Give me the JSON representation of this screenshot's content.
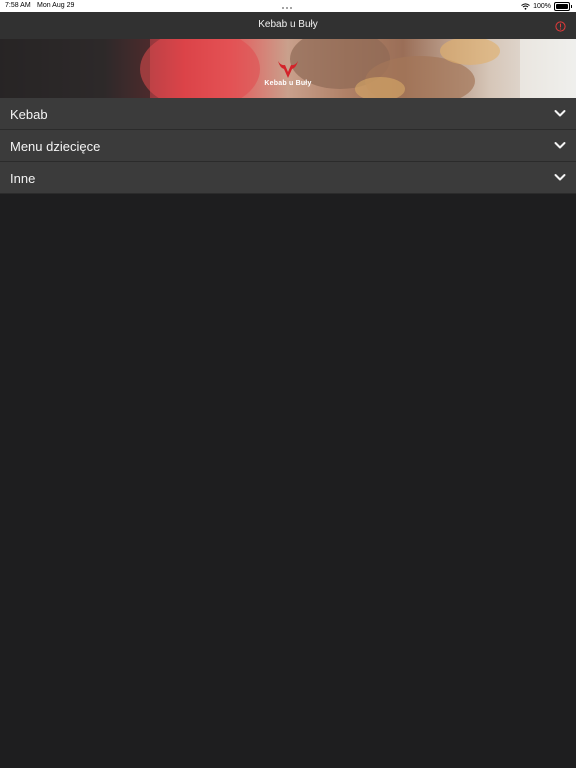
{
  "status_bar": {
    "time": "7:58 AM",
    "date": "Mon Aug 29",
    "battery_text": "100%",
    "battery_level": 1.0
  },
  "nav_bar": {
    "title": "Kebab u Buły",
    "info_icon": "info-circle-icon",
    "accent_color": "#e23a3a"
  },
  "hero": {
    "logo_text": "Kebab u Buły"
  },
  "menu": {
    "items": [
      {
        "label": "Kebab",
        "icon": "chevron-down-icon"
      },
      {
        "label": "Menu dziecięce",
        "icon": "chevron-down-icon"
      },
      {
        "label": "Inne",
        "icon": "chevron-down-icon"
      }
    ]
  }
}
